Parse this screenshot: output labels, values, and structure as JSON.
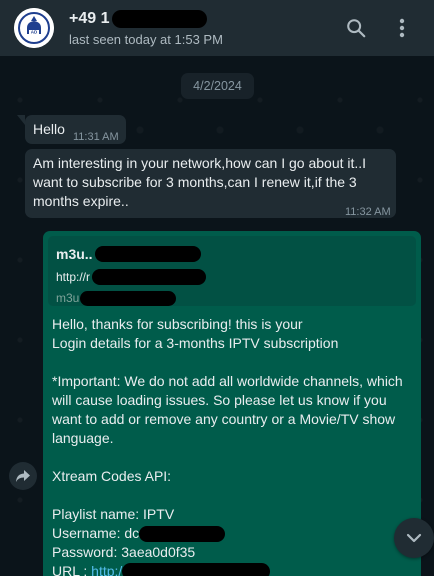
{
  "header": {
    "contact_name": "+49 1",
    "last_seen": "last seen today at 1:53 PM",
    "icons": [
      "avatar-logo",
      "search-icon",
      "more-vertical-icon"
    ]
  },
  "date_separator": "4/2/2024",
  "messages": [
    {
      "direction": "in",
      "text": "Hello",
      "time": "11:31 AM"
    },
    {
      "direction": "in",
      "lines": [
        "Am interesting in your network,how can I go about it..I",
        "want to subscribe for 3 months,can I renew it,if the 3",
        "months expire.."
      ],
      "time": "11:32 AM"
    },
    {
      "direction": "out",
      "link_preview": {
        "title": "m3u..",
        "url": "http://r",
        "host": "m3u"
      },
      "lines": [
        "Hello, thanks for subscribing! this is your",
        "Login details for a 3-months IPTV subscription",
        "",
        "*Important: We do not add all worldwide channels, which",
        "will cause loading issues. So please let us know if you",
        "want to add or remove any country or a Movie/TV show",
        "language.",
        "",
        "Xtream Codes API:",
        "",
        "Playlist name: IPTV",
        "Username: dc",
        "Password: 3aea0d0f35"
      ],
      "url_label": "URL : ",
      "url_value": "http:/."
    }
  ],
  "colors": {
    "header_bg": "#202c33",
    "chat_bg": "#0b141a",
    "incoming_bubble": "#202c33",
    "outgoing_bubble": "#005c4b",
    "link": "#53bdeb"
  }
}
